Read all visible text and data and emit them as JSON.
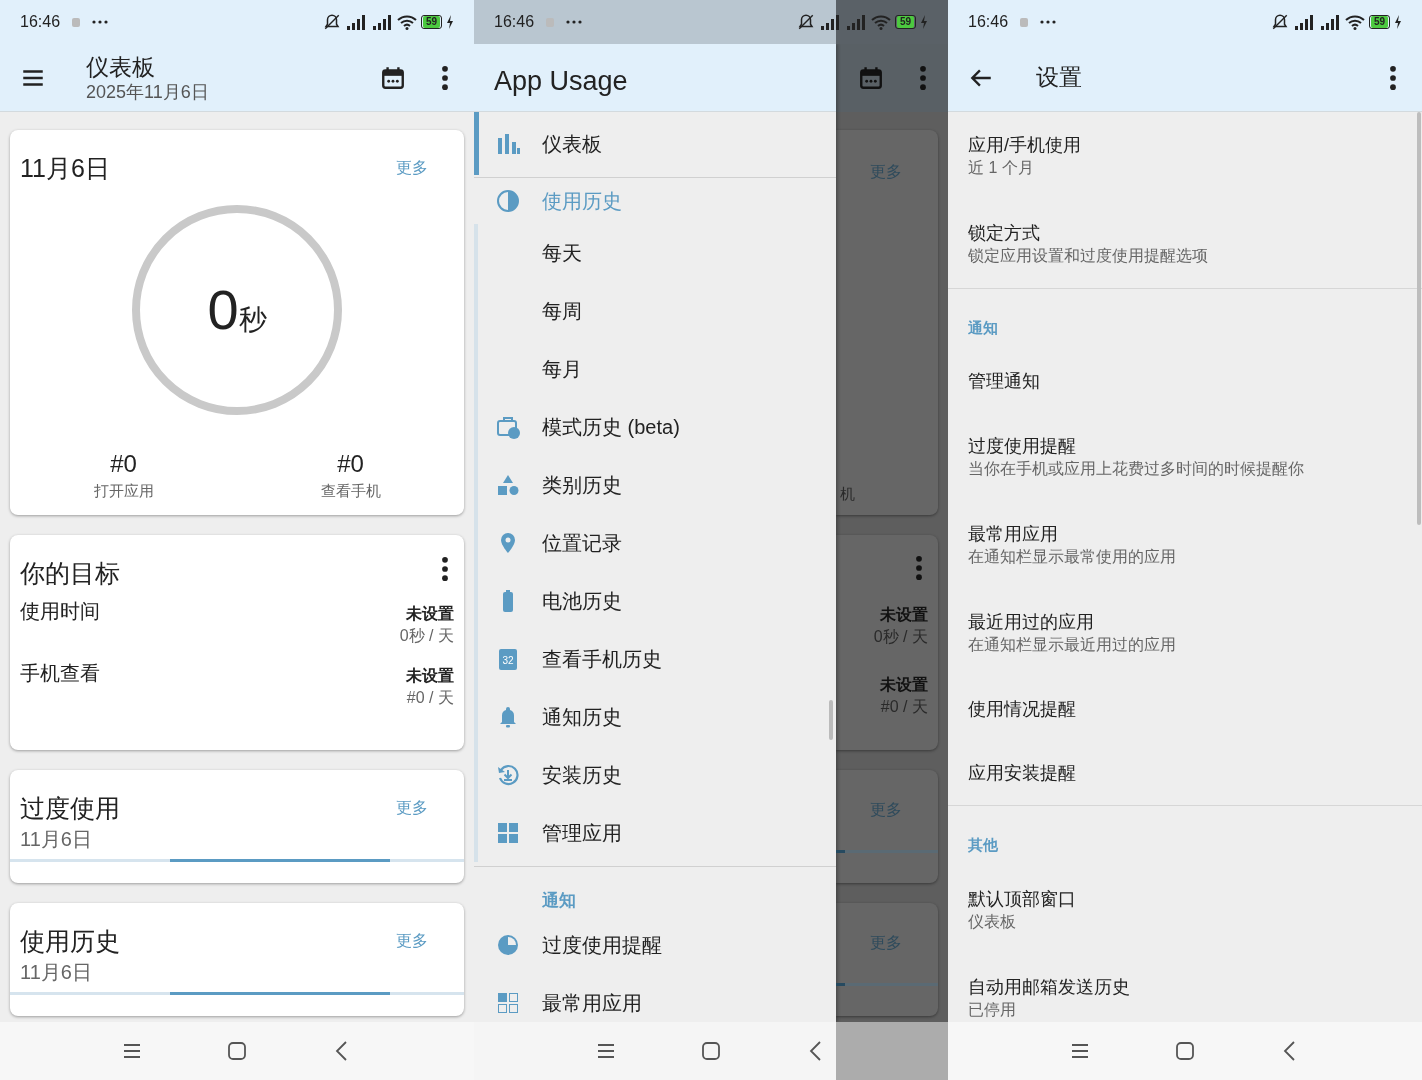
{
  "dashboard_screen": {
    "status_bar": {
      "time": "16:46",
      "battery": "59"
    },
    "app_bar": {
      "title": "仪表板",
      "subtitle": "2025年11月6日"
    },
    "today_card": {
      "title": "11月6日",
      "more": "更多",
      "total_value": "0",
      "total_unit": "秒",
      "stats": [
        {
          "value": "#0",
          "label": "打开应用"
        },
        {
          "value": "#0",
          "label": "查看手机"
        }
      ]
    },
    "goals_card": {
      "title": "你的目标",
      "goals": [
        {
          "label": "使用时间",
          "status": "未设置",
          "target": "0秒 / 天"
        },
        {
          "label": "手机查看",
          "status": "未设置",
          "target": "#0 / 天"
        }
      ]
    },
    "summary_cards": [
      {
        "title": "过度使用",
        "date": "11月6日",
        "more": "更多"
      },
      {
        "title": "使用历史",
        "date": "11月6日",
        "more": "更多"
      }
    ]
  },
  "drawer_screen": {
    "status_bar": {
      "time": "16:46",
      "battery": "59"
    },
    "drawer": {
      "title": "App Usage",
      "groups": [
        {
          "items": [
            {
              "label": "仪表板",
              "selected": true
            }
          ]
        },
        {
          "items": [
            {
              "label": "使用历史",
              "selected": false,
              "expanded": true,
              "children": [
                {
                  "kind": "plain",
                  "label": "每天",
                  "selected": false
                },
                {
                  "kind": "plain",
                  "label": "每周",
                  "selected": false
                },
                {
                  "kind": "plain",
                  "label": "每月",
                  "selected": false
                },
                {
                  "kind": "icon",
                  "label": "模式历史 (beta)",
                  "selected": false
                },
                {
                  "kind": "icon",
                  "label": "类别历史",
                  "selected": false
                },
                {
                  "kind": "icon",
                  "label": "位置记录",
                  "selected": false
                },
                {
                  "kind": "icon",
                  "label": "电池历史",
                  "selected": false
                },
                {
                  "kind": "icon",
                  "label": "查看手机历史",
                  "selected": false,
                  "icon_text": "32"
                },
                {
                  "kind": "icon",
                  "label": "通知历史",
                  "selected": false
                },
                {
                  "kind": "icon",
                  "label": "安装历史",
                  "selected": false
                },
                {
                  "kind": "icon",
                  "label": "管理应用",
                  "selected": false
                }
              ]
            }
          ]
        },
        {
          "heading": "通知",
          "items": [
            {
              "label": "过度使用提醒",
              "selected": false
            },
            {
              "label": "最常用应用",
              "selected": false
            }
          ]
        }
      ]
    },
    "backdrop": {
      "today_card": {
        "more": "更多",
        "stat_label": "机"
      },
      "goals_card": {
        "goals": [
          {
            "status": "未设置",
            "target": "0秒 / 天"
          },
          {
            "status": "未设置",
            "target": "#0 / 天"
          }
        ]
      },
      "summary_cards": [
        {
          "more": "更多"
        },
        {
          "more": "更多"
        }
      ]
    }
  },
  "settings_screen": {
    "status_bar": {
      "time": "16:46",
      "battery": "59"
    },
    "app_bar": {
      "title": "设置"
    },
    "sections": [
      {
        "items": [
          {
            "title": "应用/手机使用",
            "subtitle": "近 1 个月"
          },
          {
            "title": "锁定方式",
            "subtitle": "锁定应用设置和过度使用提醒选项"
          }
        ]
      },
      {
        "heading": "通知",
        "items": [
          {
            "title": "管理通知"
          },
          {
            "title": "过度使用提醒",
            "subtitle": "当你在手机或应用上花费过多时间的时候提醒你"
          },
          {
            "title": "最常用应用",
            "subtitle": "在通知栏显示最常使用的应用"
          },
          {
            "title": "最近用过的应用",
            "subtitle": "在通知栏显示最近用过的应用"
          },
          {
            "title": "使用情况提醒"
          },
          {
            "title": "应用安装提醒"
          }
        ]
      },
      {
        "heading": "其他",
        "items": [
          {
            "title": "默认顶部窗口",
            "subtitle": "仪表板"
          },
          {
            "title": "自动用邮箱发送历史",
            "subtitle": "已停用"
          }
        ]
      }
    ]
  }
}
